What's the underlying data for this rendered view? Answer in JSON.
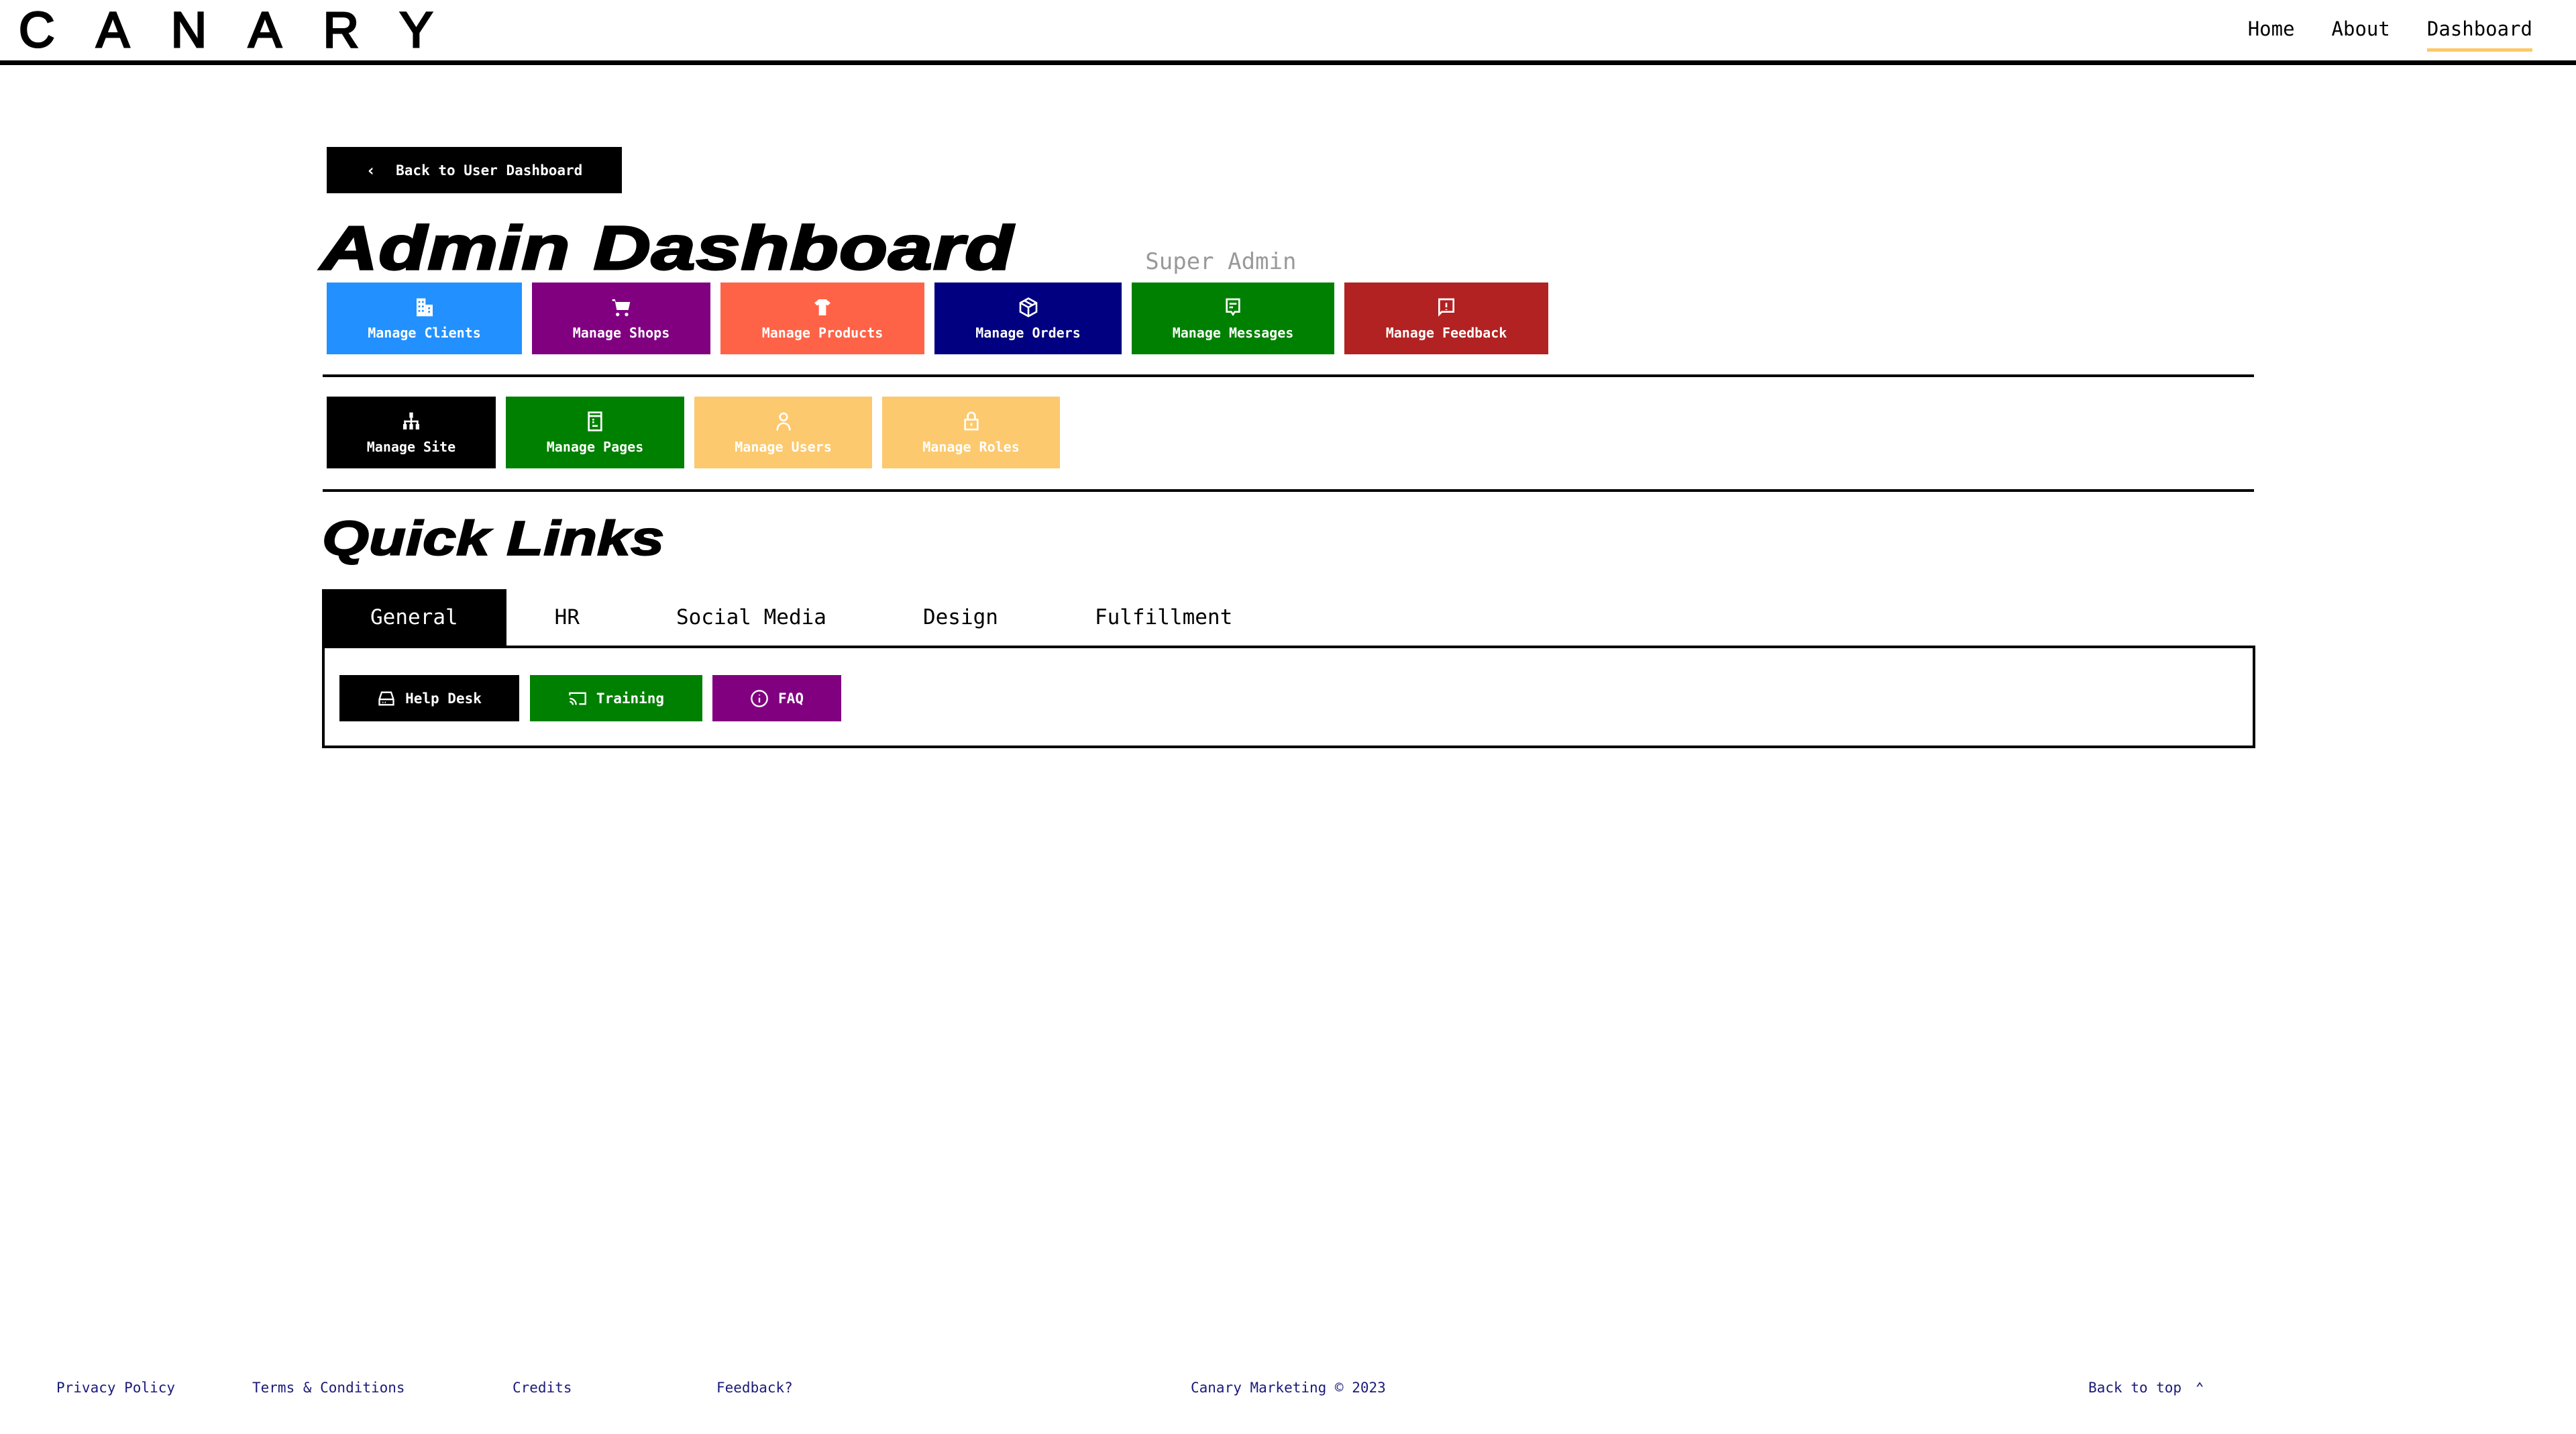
{
  "header": {
    "logo": "CANARY",
    "nav": [
      {
        "label": "Home",
        "active": false
      },
      {
        "label": "About",
        "active": false
      },
      {
        "label": "Dashboard",
        "active": true
      }
    ],
    "active_underline_color": "#fcc966"
  },
  "back_button": {
    "label": "Back to User Dashboard",
    "icon": "chevron-left-icon"
  },
  "page": {
    "title": "Admin Dashboard",
    "role": "Super Admin"
  },
  "tiles_row1": [
    {
      "label": "Manage Clients",
      "icon": "building-icon",
      "color": "#2291ff"
    },
    {
      "label": "Manage Shops",
      "icon": "cart-icon",
      "color": "#800080"
    },
    {
      "label": "Manage Products",
      "icon": "tshirt-icon",
      "color": "#ff6347"
    },
    {
      "label": "Manage Orders",
      "icon": "box-icon",
      "color": "#000080"
    },
    {
      "label": "Manage Messages",
      "icon": "message-icon",
      "color": "#008000"
    },
    {
      "label": "Manage Feedback",
      "icon": "feedback-icon",
      "color": "#b22222"
    }
  ],
  "tiles_row2": [
    {
      "label": "Manage Site",
      "icon": "sitemap-icon",
      "color": "#000000"
    },
    {
      "label": "Manage Pages",
      "icon": "page-icon",
      "color": "#008000"
    },
    {
      "label": "Manage Users",
      "icon": "user-icon",
      "color": "#fcc96e"
    },
    {
      "label": "Manage Roles",
      "icon": "lock-icon",
      "color": "#fcc96e"
    }
  ],
  "quick_links": {
    "title": "Quick Links",
    "tabs": [
      {
        "label": "General",
        "active": true
      },
      {
        "label": "HR",
        "active": false
      },
      {
        "label": "Social Media",
        "active": false
      },
      {
        "label": "Design",
        "active": false
      },
      {
        "label": "Fulfillment",
        "active": false
      }
    ],
    "links": [
      {
        "label": "Help Desk",
        "icon": "inbox-icon",
        "color": "#000000"
      },
      {
        "label": "Training",
        "icon": "cast-icon",
        "color": "#008000"
      },
      {
        "label": "FAQ",
        "icon": "info-icon",
        "color": "#800080"
      }
    ]
  },
  "footer": {
    "links": [
      "Privacy Policy",
      "Terms & Conditions",
      "Credits",
      "Feedback?"
    ],
    "copyright": "Canary Marketing © 2023",
    "back_to_top": "Back to top",
    "back_to_top_icon": "chevron-up-icon"
  }
}
